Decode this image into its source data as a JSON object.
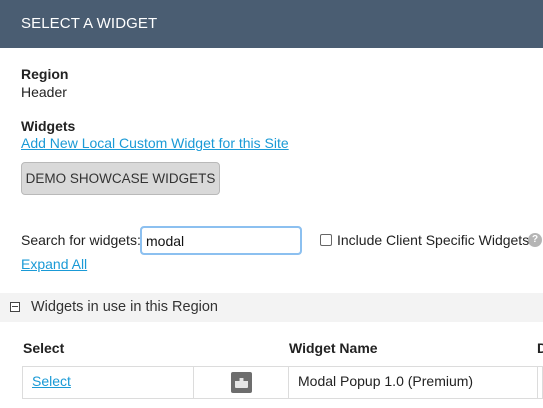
{
  "header": {
    "title": "SELECT A WIDGET"
  },
  "region": {
    "label": "Region",
    "value": "Header"
  },
  "widgets": {
    "label": "Widgets",
    "add_link": "Add New Local Custom Widget for this Site",
    "demo_button": "DEMO SHOWCASE WIDGETS"
  },
  "search": {
    "label": "Search for widgets:",
    "value": "modal",
    "include_client_label": "Include Client Specific Widgets",
    "include_client_checked": false,
    "expand_all": "Expand All"
  },
  "section": {
    "title": "Widgets in use in this Region"
  },
  "table": {
    "columns": [
      "Select",
      "Widget Name",
      "D"
    ],
    "rows": [
      {
        "select": "Select",
        "thumbnail_icon": "widget-thumbnail-icon",
        "name": "Modal Popup 1.0 (Premium)"
      }
    ]
  },
  "colors": {
    "header_bg": "#4a5d72",
    "link": "#1a9ad6"
  }
}
